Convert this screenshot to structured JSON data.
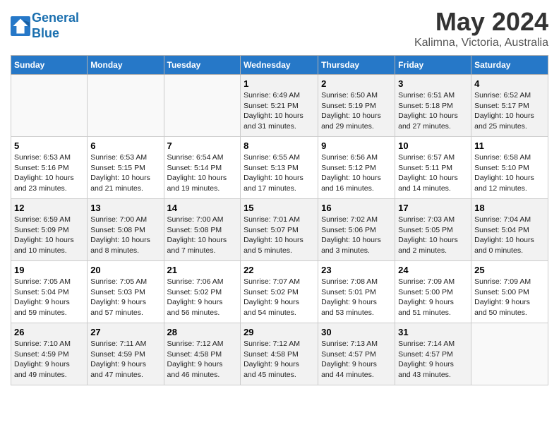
{
  "logo": {
    "line1": "General",
    "line2": "Blue"
  },
  "title": "May 2024",
  "subtitle": "Kalimna, Victoria, Australia",
  "days_of_week": [
    "Sunday",
    "Monday",
    "Tuesday",
    "Wednesday",
    "Thursday",
    "Friday",
    "Saturday"
  ],
  "weeks": [
    [
      {
        "day": "",
        "info": ""
      },
      {
        "day": "",
        "info": ""
      },
      {
        "day": "",
        "info": ""
      },
      {
        "day": "1",
        "info": "Sunrise: 6:49 AM\nSunset: 5:21 PM\nDaylight: 10 hours\nand 31 minutes."
      },
      {
        "day": "2",
        "info": "Sunrise: 6:50 AM\nSunset: 5:19 PM\nDaylight: 10 hours\nand 29 minutes."
      },
      {
        "day": "3",
        "info": "Sunrise: 6:51 AM\nSunset: 5:18 PM\nDaylight: 10 hours\nand 27 minutes."
      },
      {
        "day": "4",
        "info": "Sunrise: 6:52 AM\nSunset: 5:17 PM\nDaylight: 10 hours\nand 25 minutes."
      }
    ],
    [
      {
        "day": "5",
        "info": "Sunrise: 6:53 AM\nSunset: 5:16 PM\nDaylight: 10 hours\nand 23 minutes."
      },
      {
        "day": "6",
        "info": "Sunrise: 6:53 AM\nSunset: 5:15 PM\nDaylight: 10 hours\nand 21 minutes."
      },
      {
        "day": "7",
        "info": "Sunrise: 6:54 AM\nSunset: 5:14 PM\nDaylight: 10 hours\nand 19 minutes."
      },
      {
        "day": "8",
        "info": "Sunrise: 6:55 AM\nSunset: 5:13 PM\nDaylight: 10 hours\nand 17 minutes."
      },
      {
        "day": "9",
        "info": "Sunrise: 6:56 AM\nSunset: 5:12 PM\nDaylight: 10 hours\nand 16 minutes."
      },
      {
        "day": "10",
        "info": "Sunrise: 6:57 AM\nSunset: 5:11 PM\nDaylight: 10 hours\nand 14 minutes."
      },
      {
        "day": "11",
        "info": "Sunrise: 6:58 AM\nSunset: 5:10 PM\nDaylight: 10 hours\nand 12 minutes."
      }
    ],
    [
      {
        "day": "12",
        "info": "Sunrise: 6:59 AM\nSunset: 5:09 PM\nDaylight: 10 hours\nand 10 minutes."
      },
      {
        "day": "13",
        "info": "Sunrise: 7:00 AM\nSunset: 5:08 PM\nDaylight: 10 hours\nand 8 minutes."
      },
      {
        "day": "14",
        "info": "Sunrise: 7:00 AM\nSunset: 5:08 PM\nDaylight: 10 hours\nand 7 minutes."
      },
      {
        "day": "15",
        "info": "Sunrise: 7:01 AM\nSunset: 5:07 PM\nDaylight: 10 hours\nand 5 minutes."
      },
      {
        "day": "16",
        "info": "Sunrise: 7:02 AM\nSunset: 5:06 PM\nDaylight: 10 hours\nand 3 minutes."
      },
      {
        "day": "17",
        "info": "Sunrise: 7:03 AM\nSunset: 5:05 PM\nDaylight: 10 hours\nand 2 minutes."
      },
      {
        "day": "18",
        "info": "Sunrise: 7:04 AM\nSunset: 5:04 PM\nDaylight: 10 hours\nand 0 minutes."
      }
    ],
    [
      {
        "day": "19",
        "info": "Sunrise: 7:05 AM\nSunset: 5:04 PM\nDaylight: 9 hours\nand 59 minutes."
      },
      {
        "day": "20",
        "info": "Sunrise: 7:05 AM\nSunset: 5:03 PM\nDaylight: 9 hours\nand 57 minutes."
      },
      {
        "day": "21",
        "info": "Sunrise: 7:06 AM\nSunset: 5:02 PM\nDaylight: 9 hours\nand 56 minutes."
      },
      {
        "day": "22",
        "info": "Sunrise: 7:07 AM\nSunset: 5:02 PM\nDaylight: 9 hours\nand 54 minutes."
      },
      {
        "day": "23",
        "info": "Sunrise: 7:08 AM\nSunset: 5:01 PM\nDaylight: 9 hours\nand 53 minutes."
      },
      {
        "day": "24",
        "info": "Sunrise: 7:09 AM\nSunset: 5:00 PM\nDaylight: 9 hours\nand 51 minutes."
      },
      {
        "day": "25",
        "info": "Sunrise: 7:09 AM\nSunset: 5:00 PM\nDaylight: 9 hours\nand 50 minutes."
      }
    ],
    [
      {
        "day": "26",
        "info": "Sunrise: 7:10 AM\nSunset: 4:59 PM\nDaylight: 9 hours\nand 49 minutes."
      },
      {
        "day": "27",
        "info": "Sunrise: 7:11 AM\nSunset: 4:59 PM\nDaylight: 9 hours\nand 47 minutes."
      },
      {
        "day": "28",
        "info": "Sunrise: 7:12 AM\nSunset: 4:58 PM\nDaylight: 9 hours\nand 46 minutes."
      },
      {
        "day": "29",
        "info": "Sunrise: 7:12 AM\nSunset: 4:58 PM\nDaylight: 9 hours\nand 45 minutes."
      },
      {
        "day": "30",
        "info": "Sunrise: 7:13 AM\nSunset: 4:57 PM\nDaylight: 9 hours\nand 44 minutes."
      },
      {
        "day": "31",
        "info": "Sunrise: 7:14 AM\nSunset: 4:57 PM\nDaylight: 9 hours\nand 43 minutes."
      },
      {
        "day": "",
        "info": ""
      }
    ]
  ]
}
